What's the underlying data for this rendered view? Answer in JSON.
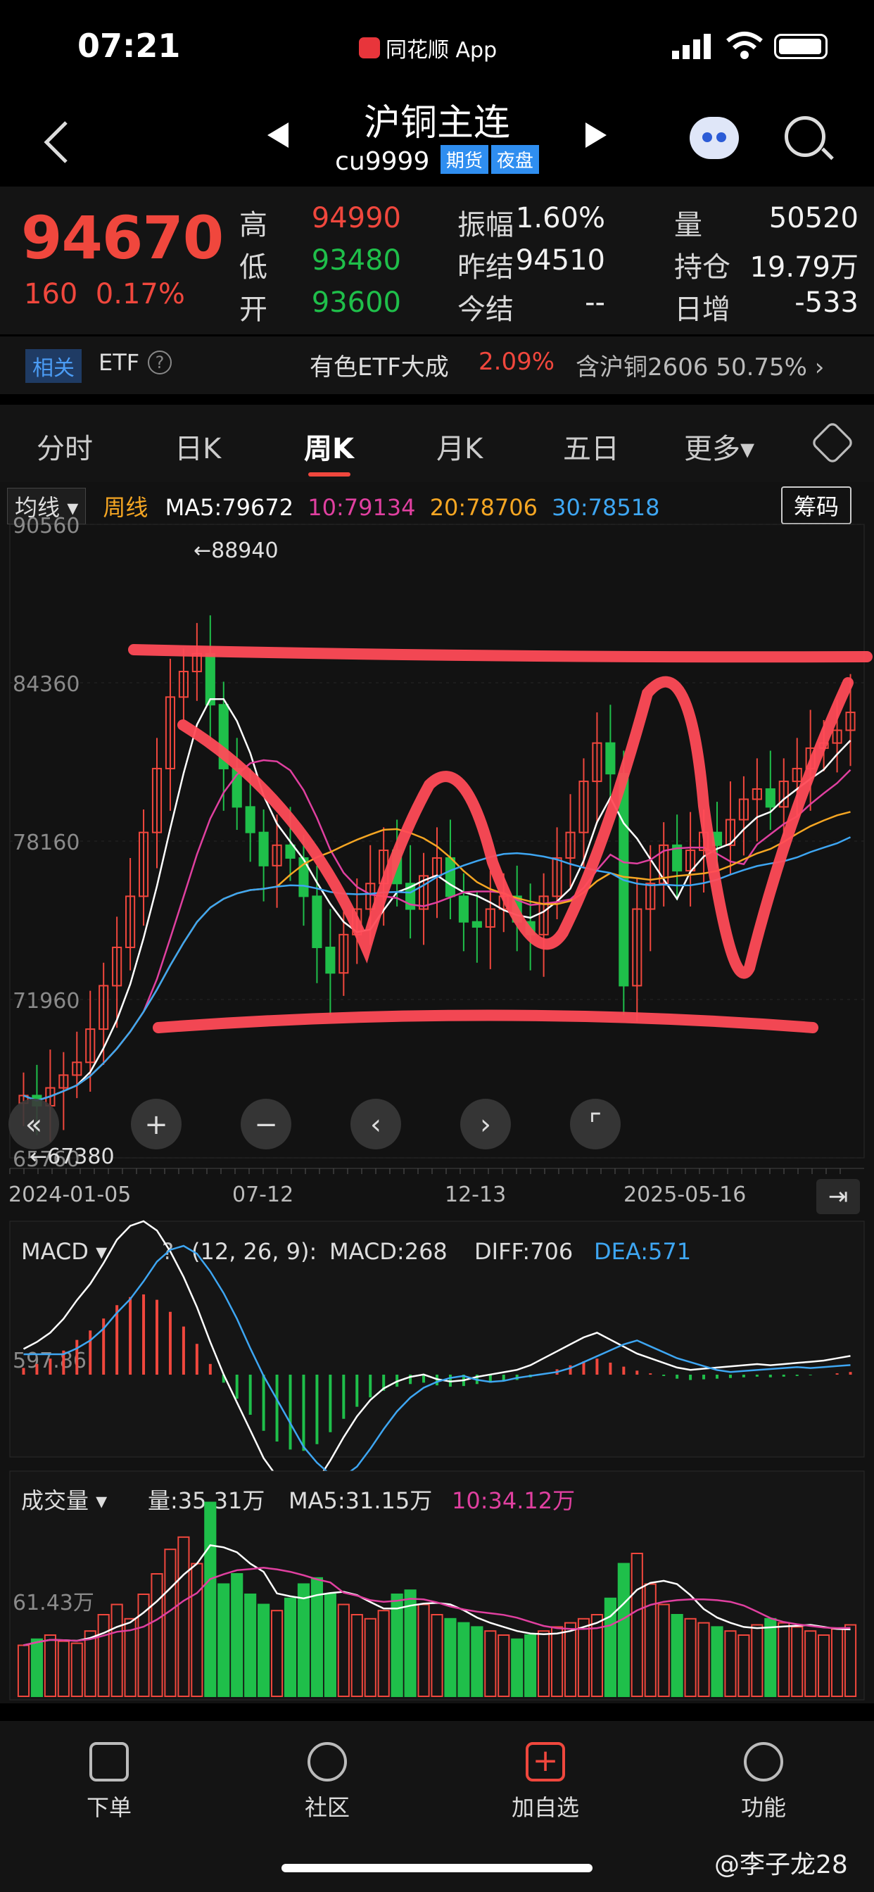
{
  "status_bar": {
    "time": "07:21",
    "app_name": "同花顺 App"
  },
  "nav": {
    "title": "沪铜主连",
    "code": "cu9999",
    "tags": [
      "期货",
      "夜盘"
    ],
    "icons": {
      "back": "chevron-left-icon",
      "prev": "triangle-left-icon",
      "next": "triangle-right-icon",
      "robot": "robot-icon",
      "search": "search-icon"
    }
  },
  "quote": {
    "price": "94670",
    "change": "160",
    "change_pct": "0.17%",
    "rows": [
      [
        {
          "label": "高",
          "value": "94990",
          "color": "red"
        },
        {
          "label": "振幅",
          "value": "1.60%",
          "color": "white"
        },
        {
          "label": "量",
          "value": "50520",
          "color": "white"
        }
      ],
      [
        {
          "label": "低",
          "value": "93480",
          "color": "green"
        },
        {
          "label": "昨结",
          "value": "94510",
          "color": "white"
        },
        {
          "label": "持仓",
          "value": "19.79万",
          "color": "white"
        }
      ],
      [
        {
          "label": "开",
          "value": "93600",
          "color": "green"
        },
        {
          "label": "今结",
          "value": "--",
          "color": "white"
        },
        {
          "label": "日增",
          "value": "-533",
          "color": "white"
        }
      ]
    ]
  },
  "related": {
    "tag": "相关",
    "etf_label": "ETF",
    "etf_name": "有色ETF大成",
    "etf_pct": "2.09%",
    "sub": "含沪铜2606 50.75%"
  },
  "tabs": [
    "分时",
    "日K",
    "周K",
    "月K",
    "五日",
    "更多▾"
  ],
  "active_tab": "周K",
  "ma_bar": {
    "selector": "均线",
    "period": "周线",
    "ma5": "MA5:79672",
    "ma10": "10:79134",
    "ma20": "20:78706",
    "ma30": "30:78518",
    "chip_button": "筹码",
    "colors": {
      "ma5": "#ffffff",
      "ma10": "#e040a0",
      "ma20": "#f5a623",
      "ma30": "#3ea6f2",
      "period": "#f5a623"
    }
  },
  "main_chart": {
    "y_ticks": [
      "90560",
      "84360",
      "78160",
      "71960",
      "65760"
    ],
    "high_marker": "←88940",
    "low_marker": "←67380",
    "x_ticks": [
      "2024-01-05",
      "07-12",
      "12-13",
      "2025-05-16"
    ],
    "controls": [
      "double-chevron-left-icon",
      "plus-icon",
      "minus-icon",
      "chevron-left-icon",
      "chevron-right-icon",
      "expand-icon",
      "jump-to-end-icon"
    ]
  },
  "macd_bar": {
    "selector": "MACD",
    "params": "(12, 26, 9):",
    "macd": "MACD:268",
    "diff": "DIFF:706",
    "dea": "DEA:571",
    "y_tick": "597.86"
  },
  "volume_bar": {
    "selector": "成交量",
    "vol": "量:35.31万",
    "ma5": "MA5:31.15万",
    "ma10": "10:34.12万",
    "y_tick": "61.43万"
  },
  "tabbar": [
    {
      "label": "下单",
      "icon": "order-icon"
    },
    {
      "label": "社区",
      "icon": "community-icon"
    },
    {
      "label": "加自选",
      "icon": "add-watchlist-icon"
    },
    {
      "label": "功能",
      "icon": "menu-icon"
    }
  ],
  "watermark": "@李子龙28",
  "chart_data": [
    {
      "type": "candlestick",
      "title": "沪铜主连 周K",
      "ylim": [
        65760,
        90560
      ],
      "y_ticks": [
        90560,
        84360,
        78160,
        71960,
        65760
      ],
      "x_ticks": [
        "2024-01-05",
        "07-12",
        "12-13",
        "2025-05-16"
      ],
      "closes": [
        68200,
        67800,
        68500,
        69000,
        69500,
        70800,
        72500,
        74000,
        76000,
        78500,
        81000,
        83800,
        84800,
        85500,
        83500,
        81000,
        79500,
        78500,
        77200,
        78000,
        77500,
        76000,
        74000,
        73000,
        74500,
        75500,
        76500,
        77800,
        76500,
        75500,
        76800,
        77500,
        76000,
        75000,
        74800,
        75500,
        76000,
        75000,
        74500,
        76000,
        77500,
        78500,
        80500,
        82000,
        80800,
        72500,
        75500,
        76500,
        78000,
        77000,
        77800,
        78500,
        78000,
        79000,
        79800,
        80200,
        79500,
        80500,
        81000,
        81800,
        82000,
        82500,
        83200
      ],
      "series": [
        {
          "name": "MA5",
          "color": "#ffffff"
        },
        {
          "name": "MA10",
          "color": "#e040a0"
        },
        {
          "name": "MA20",
          "color": "#f5a623"
        },
        {
          "name": "MA30",
          "color": "#3ea6f2"
        }
      ]
    },
    {
      "type": "bar",
      "title": "MACD",
      "values": [
        50,
        80,
        120,
        180,
        260,
        330,
        420,
        520,
        580,
        600,
        560,
        470,
        360,
        230,
        80,
        -60,
        -180,
        -300,
        -420,
        -500,
        -560,
        -570,
        -520,
        -430,
        -330,
        -240,
        -170,
        -120,
        -90,
        -70,
        -60,
        -80,
        -90,
        -85,
        -70,
        -60,
        -50,
        -40,
        -20,
        10,
        40,
        70,
        100,
        120,
        90,
        60,
        30,
        10,
        -10,
        -30,
        -40,
        -35,
        -30,
        -25,
        -20,
        -15,
        -20,
        -15,
        -10,
        -5,
        0,
        10,
        20
      ],
      "diff_line": "white",
      "dea_line": "#3ea6f2"
    },
    {
      "type": "bar",
      "title": "成交量",
      "unit": "万",
      "y_tick": 61.43,
      "values": [
        25,
        28,
        30,
        27,
        26,
        32,
        40,
        45,
        38,
        50,
        60,
        72,
        78,
        65,
        95,
        55,
        60,
        50,
        45,
        42,
        48,
        55,
        58,
        50,
        45,
        40,
        38,
        42,
        50,
        52,
        45,
        40,
        38,
        36,
        34,
        32,
        30,
        28,
        30,
        32,
        34,
        36,
        38,
        40,
        48,
        65,
        70,
        55,
        45,
        40,
        38,
        36,
        34,
        32,
        30,
        35,
        38,
        36,
        34,
        32,
        30,
        33,
        35
      ],
      "up_color": "#f0473d",
      "down_color": "#1fbf4a"
    }
  ]
}
